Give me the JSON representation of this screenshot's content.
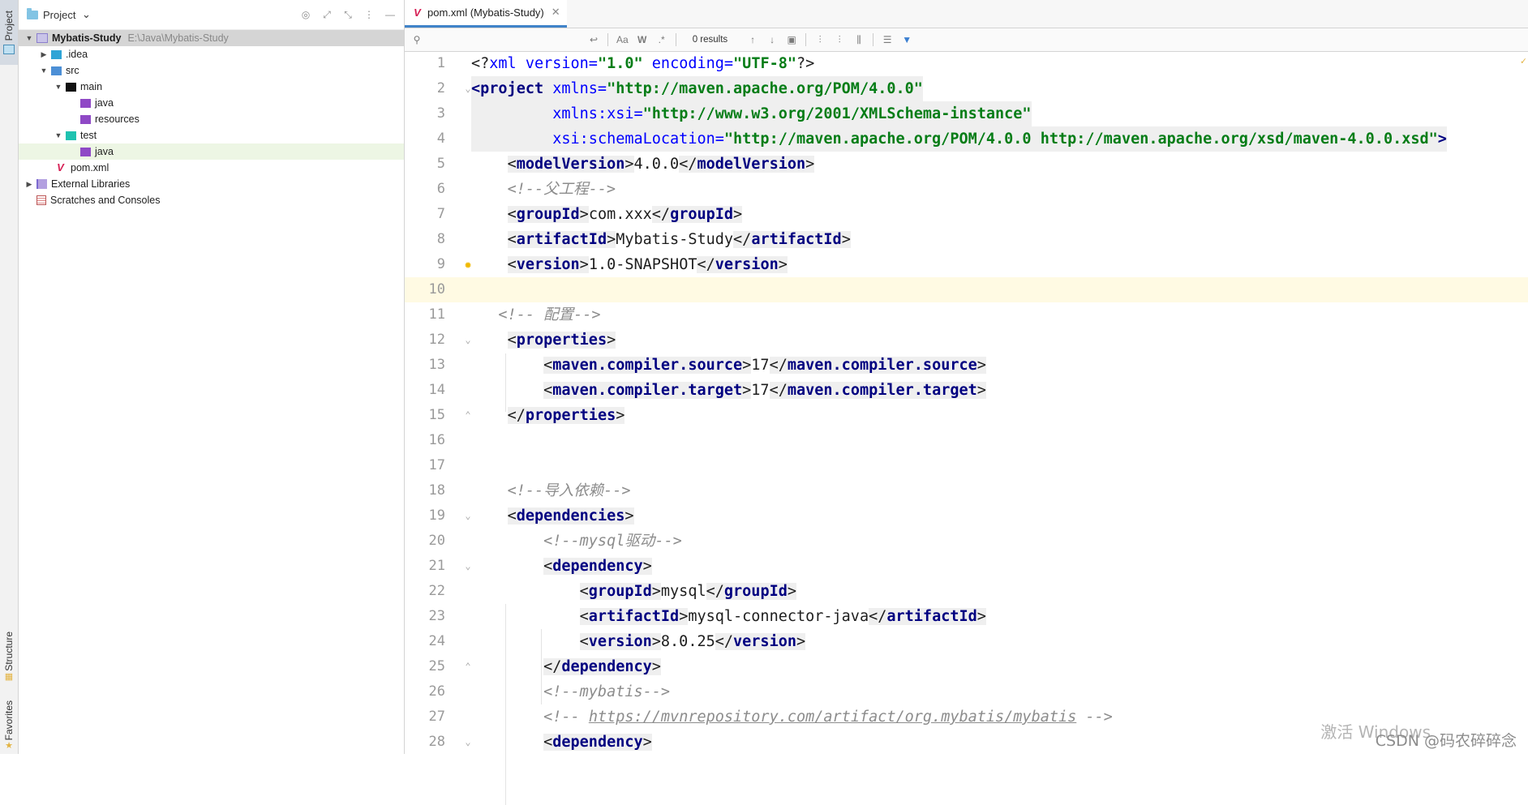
{
  "stripe": {
    "project": "Project",
    "structure": "Structure",
    "favorites": "Favorites"
  },
  "project_panel": {
    "title": "Project",
    "tree": [
      {
        "name": "Mybatis-Study",
        "path": "E:\\Java\\Mybatis-Study",
        "icon": "module-folder-icon"
      },
      {
        "name": ".idea",
        "icon": "idea-folder-icon"
      },
      {
        "name": "src",
        "icon": "source-folder-icon"
      },
      {
        "name": "main",
        "icon": "folder-icon"
      },
      {
        "name": "java",
        "icon": "java-source-root-icon"
      },
      {
        "name": "resources",
        "icon": "resources-root-icon"
      },
      {
        "name": "test",
        "icon": "test-folder-icon"
      },
      {
        "name": "java",
        "icon": "test-source-root-icon"
      },
      {
        "name": "pom.xml",
        "icon": "maven-icon"
      },
      {
        "name": "External Libraries",
        "icon": "libraries-icon"
      },
      {
        "name": "Scratches and Consoles",
        "icon": "scratches-icon"
      }
    ]
  },
  "editor": {
    "tab_label": "pom.xml (Mybatis-Study)",
    "find": {
      "placeholder": "",
      "results": "0 results",
      "match_case": "Aa",
      "words": "W",
      "regex": ".*"
    },
    "line_numbers": [
      "1",
      "2",
      "3",
      "4",
      "5",
      "6",
      "7",
      "8",
      "9",
      "10",
      "11",
      "12",
      "13",
      "14",
      "15",
      "16",
      "17",
      "18",
      "19",
      "20",
      "21",
      "22",
      "23",
      "24",
      "25",
      "26",
      "27",
      "28"
    ],
    "code": {
      "pi_open": "<?",
      "pi_name": "xml",
      "pi_version_attr": " version=",
      "pi_version_val": "\"1.0\"",
      "pi_encoding_attr": " encoding=",
      "pi_encoding_val": "\"UTF-8\"",
      "pi_close": "?>",
      "l2_open": "<",
      "l2_tag": "project",
      "l2_attr": " xmlns=",
      "l2_val": "\"http://maven.apache.org/POM/4.0.0\"",
      "l3_attr": "xmlns:xsi=",
      "l3_val": "\"http://www.w3.org/2001/XMLSchema-instance\"",
      "l4_attr": "xsi:schemaLocation=",
      "l4_val": "\"http://maven.apache.org/POM/4.0.0 http://maven.apache.org/xsd/maven-4.0.0.xsd\"",
      "l4_close": ">",
      "model_tag": "modelVersion",
      "model_val": "4.0.0",
      "cmt_parent": "<!--父工程-->",
      "group_tag": "groupId",
      "group_val": "com.xxx",
      "artifact_tag": "artifactId",
      "artifact_val": "Mybatis-Study",
      "version_tag": "version",
      "version_val": "1.0-SNAPSHOT",
      "cmt_config": "<!-- 配置-->",
      "props_tag": "properties",
      "source_tag": "maven.compiler.source",
      "source_val": "17",
      "target_tag": "maven.compiler.target",
      "target_val": "17",
      "cmt_deps": "<!--导入依赖-->",
      "deps_tag": "dependencies",
      "cmt_mysql": "<!--mysql驱动-->",
      "dep_tag": "dependency",
      "mysql_group": "mysql",
      "mysql_artifact": "mysql-connector-java",
      "mysql_version": "8.0.25",
      "cmt_mybatis": "<!--mybatis-->",
      "cmt_url_open": "<!-- ",
      "cmt_url": "https://mvnrepository.com/artifact/org.mybatis/mybatis",
      "cmt_url_close": " -->"
    }
  },
  "overlay": {
    "activate": "激活 Windows",
    "watermark": "CSDN @码农碎碎念"
  }
}
